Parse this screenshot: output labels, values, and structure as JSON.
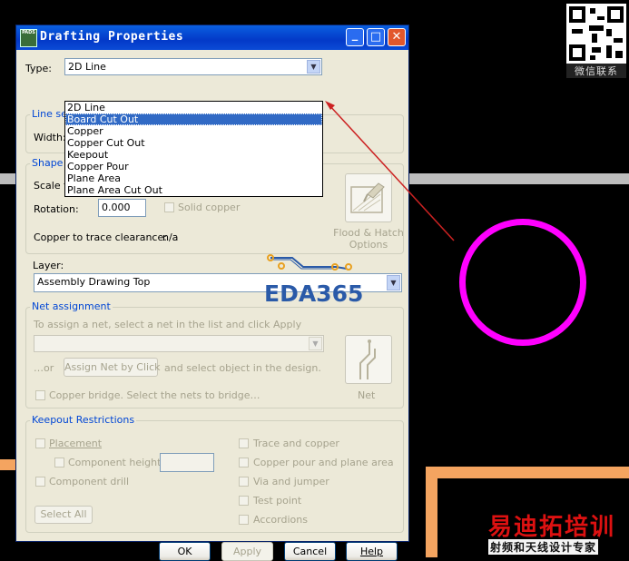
{
  "window": {
    "title": "Drafting Properties",
    "app_icon_text": "PADS",
    "minimize": "_",
    "maximize": "□",
    "close": "✕"
  },
  "type": {
    "label": "Type:",
    "value": "2D Line"
  },
  "type_options": [
    "2D Line",
    "Board Cut Out",
    "Copper",
    "Copper Cut Out",
    "Keepout",
    "Copper Pour",
    "Plane Area",
    "Plane Area Cut Out"
  ],
  "selected_option_index": 1,
  "line_settings": {
    "title": "Line set",
    "width_label": "Width:"
  },
  "shape_settings": {
    "title": "Shape s",
    "scale_label": "Scale fa",
    "rotation_label": "Rotation:",
    "rotation_value": "0.000",
    "solid_copper": "Solid copper",
    "clearance_label": "Copper to trace clearance:",
    "clearance_value": "n/a",
    "flood_hatch": "Flood & Hatch Options"
  },
  "layer": {
    "label": "Layer:",
    "value": "Assembly Drawing Top"
  },
  "net_assignment": {
    "title": "Net assignment",
    "instruction": "To assign a net, select a net in the list and click Apply",
    "or_label": "…or",
    "assign_button": "Assign Net by Click",
    "and_select": "and select object in the design.",
    "copper_bridge": "Copper bridge. Select the nets to bridge…",
    "net_button": "Net"
  },
  "keepout": {
    "title": "Keepout Restrictions",
    "placement": "Placement",
    "component_height": "Component height",
    "component_drill": "Component drill",
    "trace_copper": "Trace and copper",
    "copper_pour_plane": "Copper pour and plane area",
    "via_jumper": "Via and jumper",
    "test_point": "Test point",
    "accordions": "Accordions",
    "select_all": "Select All"
  },
  "buttons": {
    "ok": "OK",
    "apply": "Apply",
    "cancel": "Cancel",
    "help": "Help"
  },
  "watermarks": {
    "eda": "EDA365",
    "qr_caption": "微信联系",
    "brand_red": "易迪拓培训",
    "brand_sub": "射频和天线设计专家"
  },
  "colors": {
    "ring": "#ff00ff",
    "arrow": "#cc2222",
    "title_blue": "#0339c8",
    "group_title": "#0046d5"
  }
}
